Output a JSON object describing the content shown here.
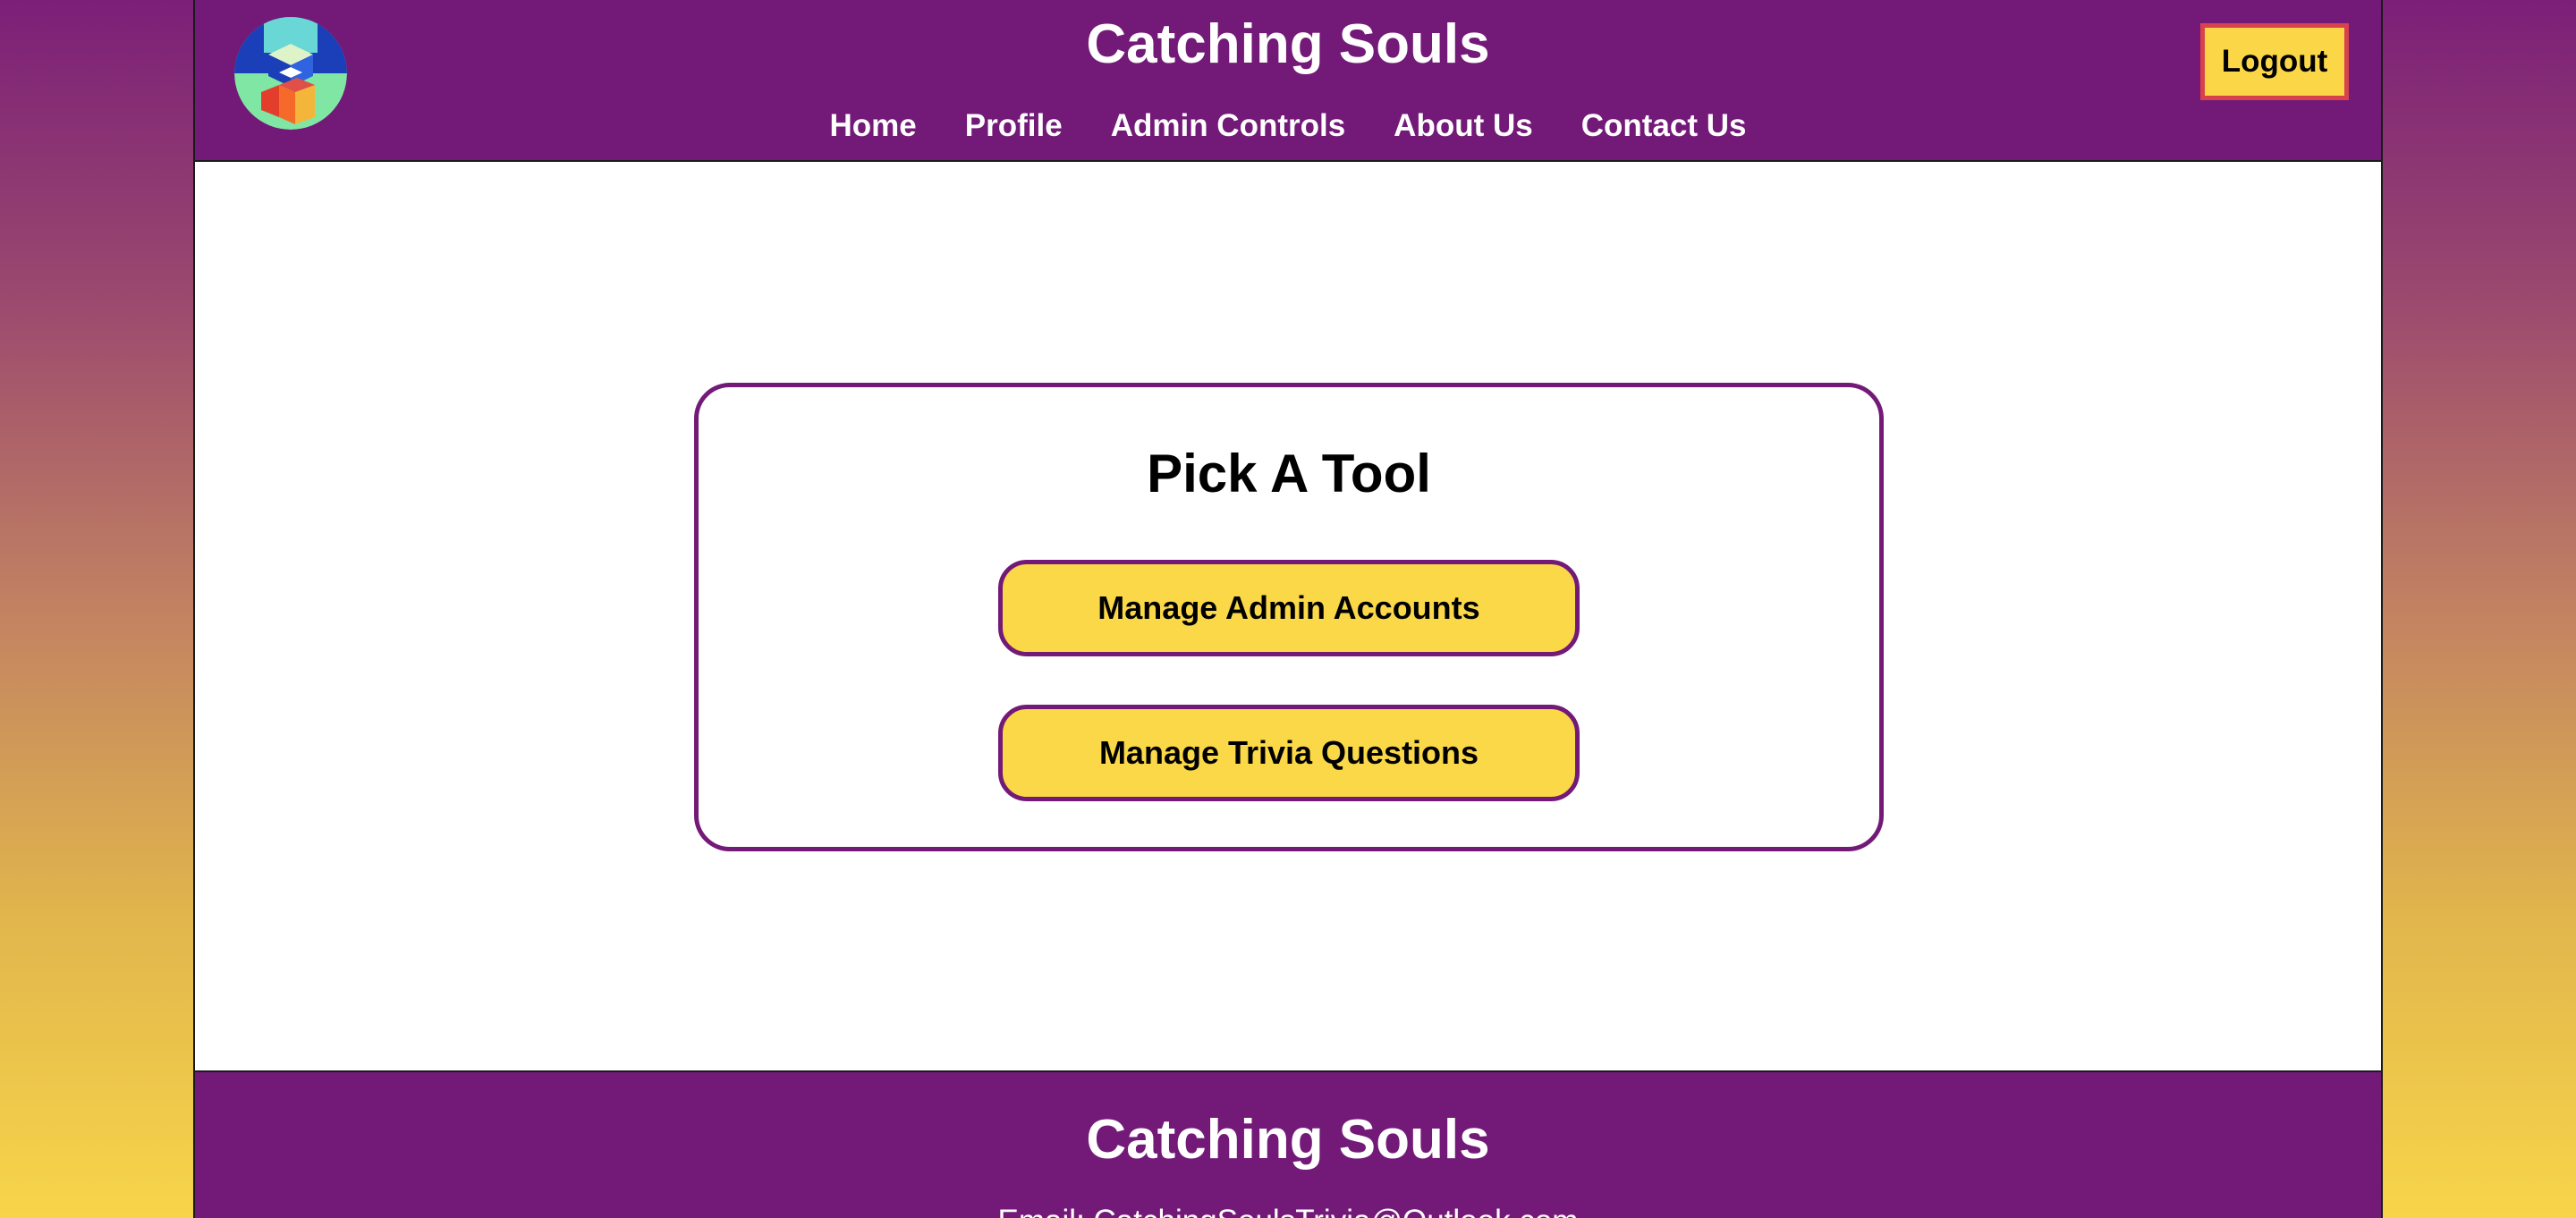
{
  "header": {
    "site_title": "Catching Souls",
    "logout_label": "Logout",
    "logo_icon": "book-cube-logo-icon",
    "nav": [
      {
        "label": "Home"
      },
      {
        "label": "Profile"
      },
      {
        "label": "Admin Controls"
      },
      {
        "label": "About Us"
      },
      {
        "label": "Contact Us"
      }
    ]
  },
  "main": {
    "card_title": "Pick A Tool",
    "buttons": [
      {
        "label": "Manage Admin Accounts"
      },
      {
        "label": "Manage Trivia Questions"
      }
    ]
  },
  "footer": {
    "title": "Catching Souls",
    "email": "Email: CatchingSoulsTrivia@Outlook.com"
  },
  "colors": {
    "brand_purple": "#731a78",
    "accent_yellow": "#fad848",
    "logout_border": "#d8424c"
  }
}
